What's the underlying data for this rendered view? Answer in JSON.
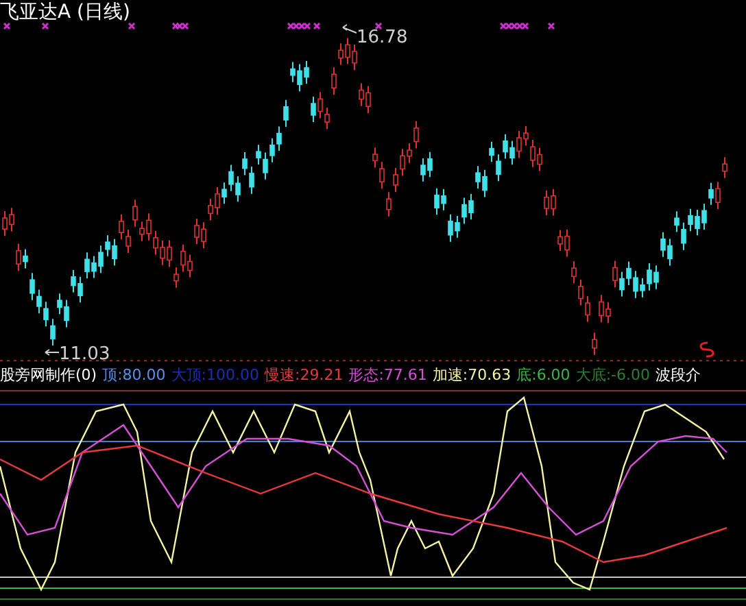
{
  "title": "飞亚达A (日线)",
  "price_labels": {
    "high": "16.78",
    "low": "11.03"
  },
  "indicator_legend": [
    {
      "text": "股旁网制作(0)",
      "color": "#ffffff"
    },
    {
      "text": "顶:80.00",
      "color": "#5a8fe6"
    },
    {
      "text": "大顶:100.00",
      "color": "#1a2fb0"
    },
    {
      "text": "慢速:29.21",
      "color": "#e8393b"
    },
    {
      "text": "形态:77.61",
      "color": "#d64fd6"
    },
    {
      "text": "加速:70.63",
      "color": "#f2f2a0"
    },
    {
      "text": "底:6.00",
      "color": "#39b54a"
    },
    {
      "text": "大底:-6.00",
      "color": "#2e7d32"
    },
    {
      "text": "波段介",
      "color": "#ffffff"
    }
  ]
}
